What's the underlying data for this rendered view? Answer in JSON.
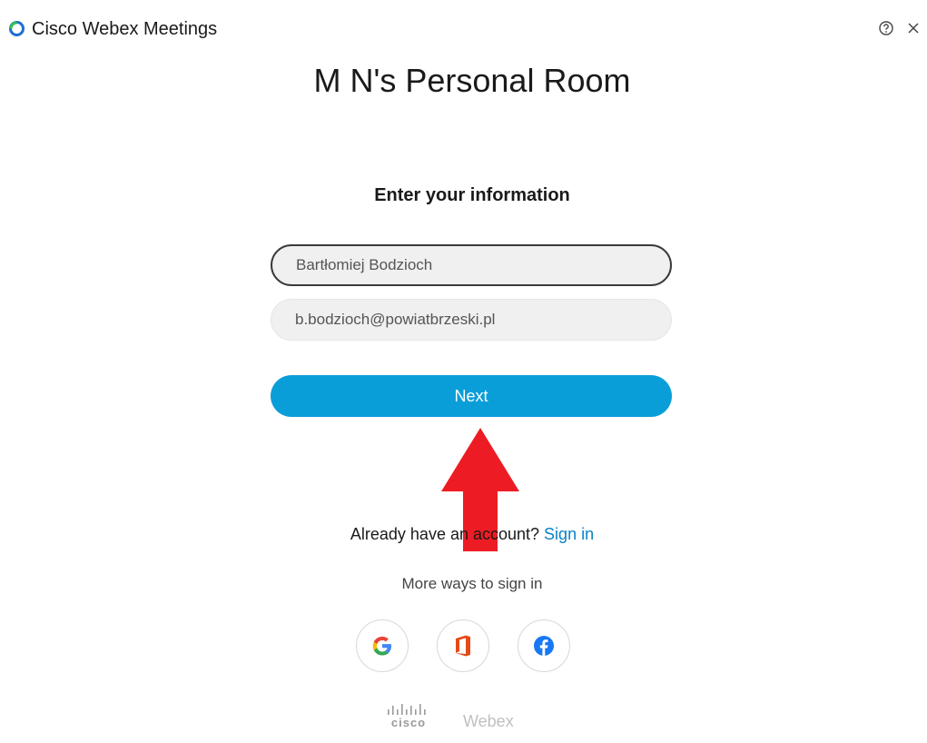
{
  "window": {
    "app_title": "Cisco Webex Meetings",
    "help_icon": "help-circle-icon",
    "close_icon": "close-icon"
  },
  "room": {
    "title": "M N's Personal Room"
  },
  "form": {
    "heading": "Enter your information",
    "name_value": "Bartłomiej Bodzioch",
    "email_value": "b.bodzioch@powiatbrzeski.pl",
    "next_label": "Next"
  },
  "account": {
    "prompt": "Already have an account? ",
    "sign_in_label": "Sign in"
  },
  "more_ways": {
    "label": "More ways to sign in",
    "providers": [
      "google-icon",
      "office-icon",
      "facebook-icon"
    ]
  },
  "footer": {
    "cisco": "cisco",
    "webex": "Webex"
  },
  "colors": {
    "accent": "#0a9ed9",
    "link": "#0a82c7",
    "annotation_arrow": "#ed1c24"
  }
}
